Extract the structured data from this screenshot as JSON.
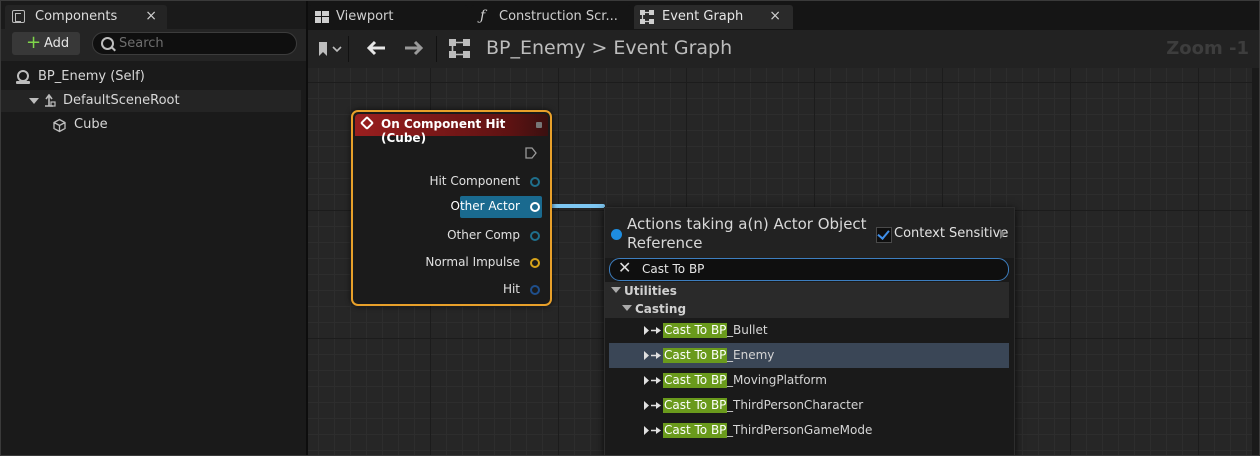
{
  "components_panel": {
    "tab_label": "Components",
    "add_label": "Add",
    "search_placeholder": "Search",
    "tree": [
      {
        "label": "BP_Enemy (Self)"
      },
      {
        "label": "DefaultSceneRoot"
      },
      {
        "label": "Cube"
      }
    ]
  },
  "tabs": [
    {
      "label": "Viewport"
    },
    {
      "label": "Construction Scr..."
    },
    {
      "label": "Event Graph"
    }
  ],
  "graph_toolbar": {
    "breadcrumb_root": "BP_Enemy",
    "breadcrumb_separator": ">",
    "breadcrumb_current": "Event Graph",
    "zoom": "Zoom -1"
  },
  "node": {
    "title": "On Component Hit (Cube)",
    "pins": [
      {
        "label": "Hit Component"
      },
      {
        "label": "Other Actor"
      },
      {
        "label": "Other Comp"
      },
      {
        "label": "Normal Impulse"
      },
      {
        "label": "Hit"
      }
    ]
  },
  "action_menu": {
    "title": "Actions taking a(n) Actor Object Reference",
    "context_sensitive_label": "Context Sensitive",
    "context_sensitive": true,
    "search_value": "Cast To BP",
    "categories": [
      {
        "label": "Utilities"
      },
      {
        "label": "Casting"
      }
    ],
    "highlight": "Cast To BP",
    "results": [
      {
        "suffix": "_Bullet"
      },
      {
        "suffix": "_Enemy",
        "selected": true
      },
      {
        "suffix": "_MovingPlatform"
      },
      {
        "suffix": "_ThirdPersonCharacter"
      },
      {
        "suffix": "_ThirdPersonGameMode"
      }
    ]
  },
  "colors": {
    "node_border": "#e8a02a",
    "node_header": "#9a1f1f",
    "highlight": "#6a9a1c",
    "selection": "#3a4656",
    "accent": "#1e8de0"
  }
}
